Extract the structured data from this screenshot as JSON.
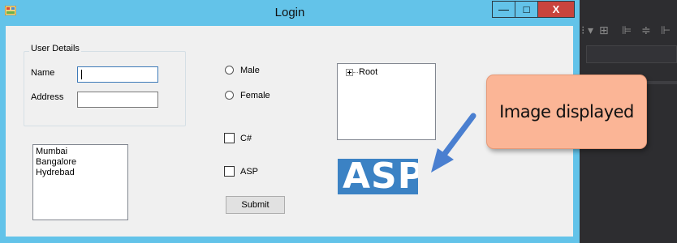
{
  "window": {
    "title": "Login",
    "minimize_glyph": "—",
    "maximize_glyph": "□",
    "close_glyph": "X"
  },
  "group": {
    "legend": "User Details",
    "name_label": "Name",
    "address_label": "Address",
    "name_value": "",
    "address_value": ""
  },
  "cities": [
    "Mumbai",
    "Bangalore",
    "Hydrebad"
  ],
  "gender": {
    "male_label": "Male",
    "female_label": "Female"
  },
  "courses": {
    "csharp_label": "C#",
    "asp_label": "ASP"
  },
  "submit_label": "Submit",
  "tree": {
    "root_label": "Root"
  },
  "picture": {
    "text": "ASP"
  },
  "annotation": {
    "text": "Image displayed",
    "arrow_color": "#4a7fd0",
    "bg_color": "#fbb596"
  },
  "colors": {
    "titlebar": "#63c3e9",
    "close": "#c9443d",
    "ide_bg": "#2d2d30"
  },
  "ide_toolbar_icons": [
    "grip-icon",
    "plus-icon",
    "align-left-icon",
    "align-center-icon",
    "align-right-icon"
  ]
}
